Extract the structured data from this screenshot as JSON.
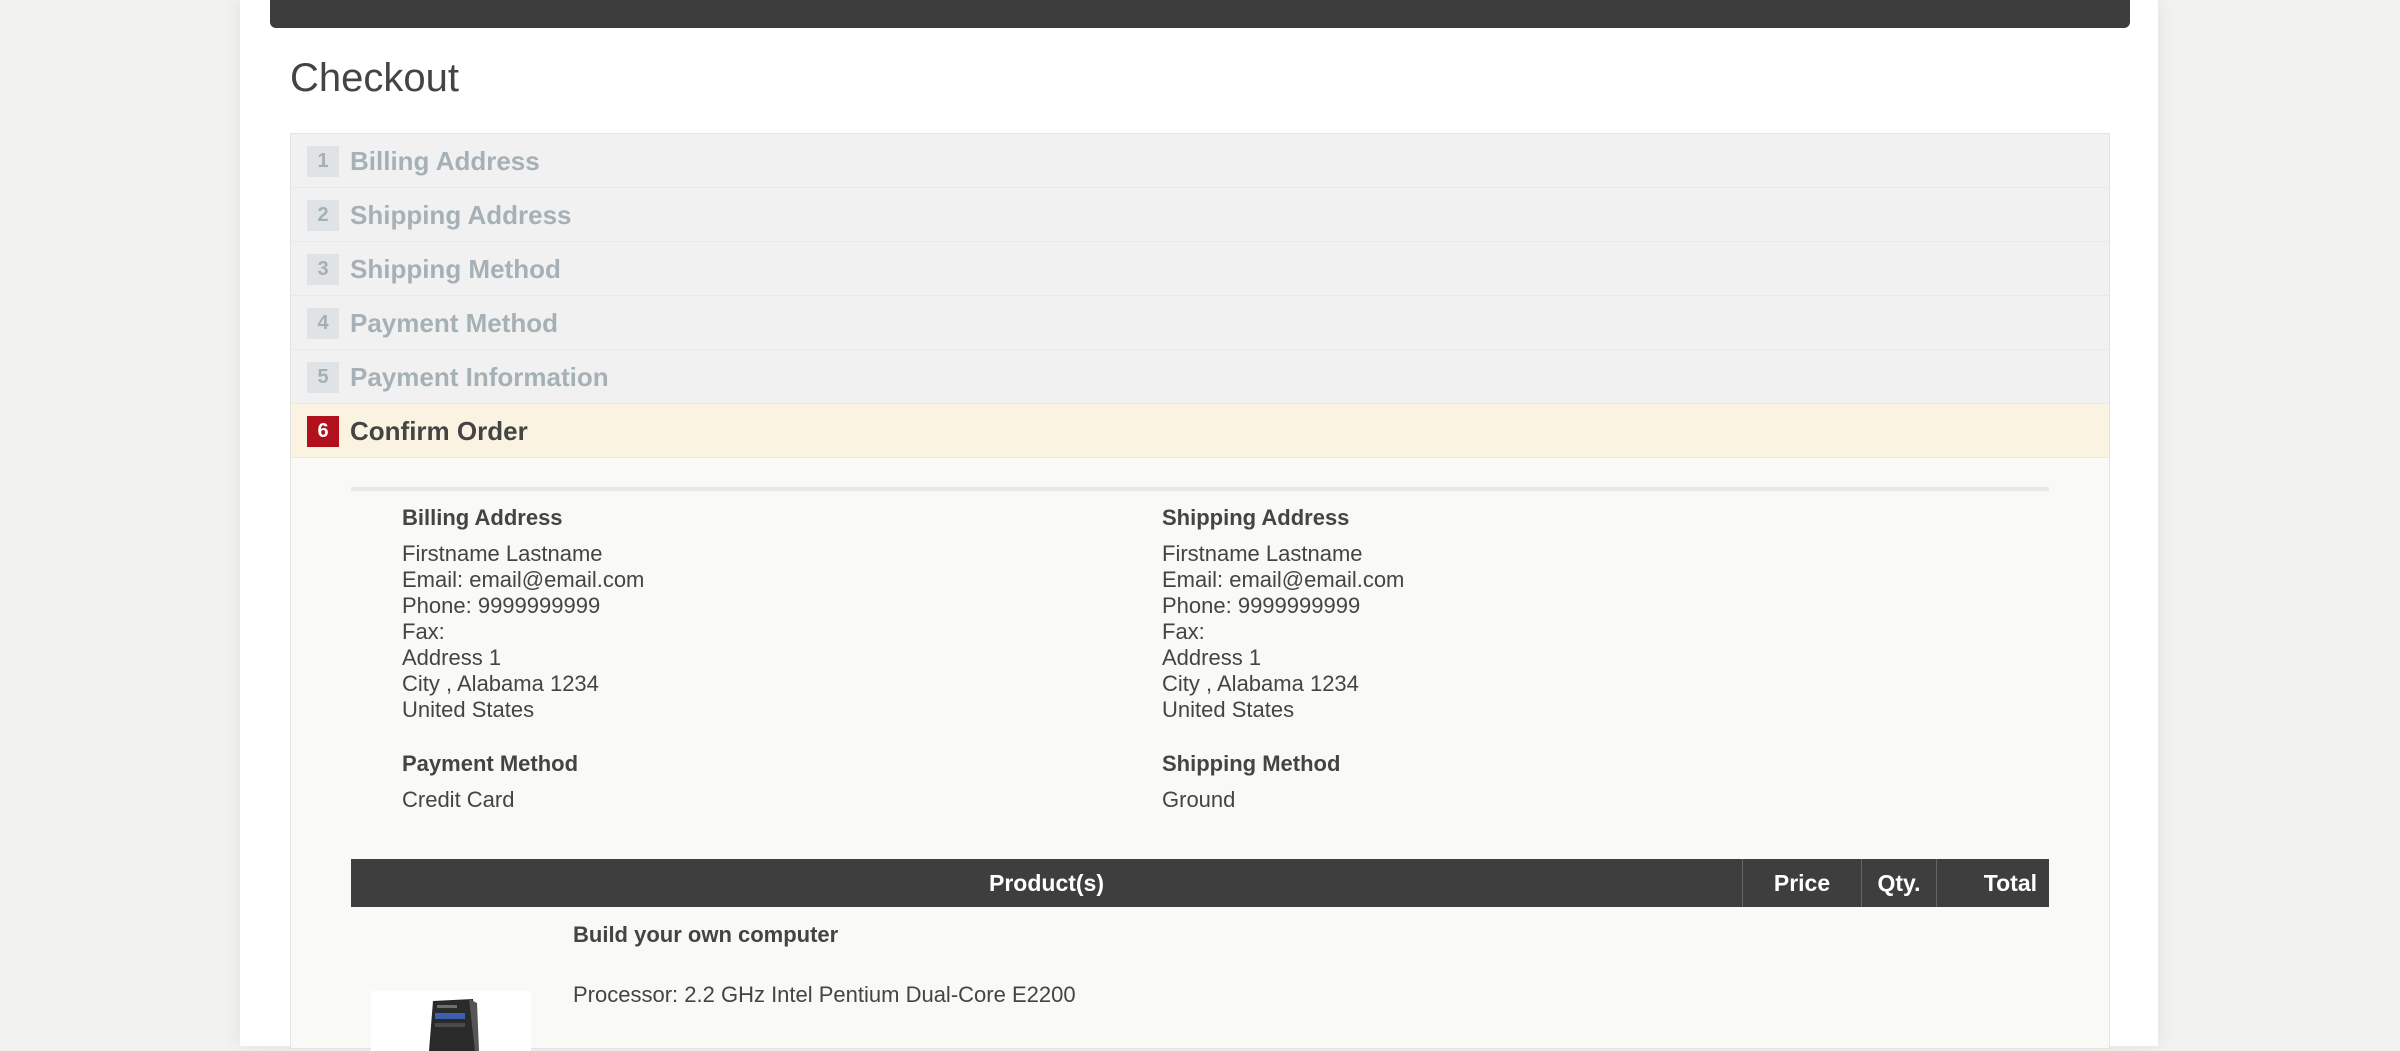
{
  "page": {
    "title": "Checkout"
  },
  "steps": [
    {
      "number": "1",
      "label": "Billing Address"
    },
    {
      "number": "2",
      "label": "Shipping Address"
    },
    {
      "number": "3",
      "label": "Shipping Method"
    },
    {
      "number": "4",
      "label": "Payment Method"
    },
    {
      "number": "5",
      "label": "Payment Information"
    },
    {
      "number": "6",
      "label": "Confirm Order"
    }
  ],
  "confirm": {
    "billing": {
      "heading": "Billing Address",
      "name": "Firstname Lastname",
      "email": "Email: email@email.com",
      "phone": "Phone: 9999999999",
      "fax": "Fax:",
      "address": "Address 1",
      "city": "City , Alabama 1234",
      "country": "United States"
    },
    "shipping": {
      "heading": "Shipping Address",
      "name": "Firstname Lastname",
      "email": "Email: email@email.com",
      "phone": "Phone: 9999999999",
      "fax": "Fax:",
      "address": "Address 1",
      "city": "City , Alabama 1234",
      "country": "United States"
    },
    "payment_method": {
      "heading": "Payment Method",
      "value": "Credit Card"
    },
    "shipping_method": {
      "heading": "Shipping Method",
      "value": "Ground"
    }
  },
  "table": {
    "headers": {
      "product": "Product(s)",
      "price": "Price",
      "qty": "Qty.",
      "total": "Total"
    },
    "rows": [
      {
        "name": "Build your own computer",
        "attribute": "Processor: 2.2 GHz Intel Pentium Dual-Core E2200"
      }
    ]
  },
  "colors": {
    "active_step": "#b2101c",
    "header_bar": "#3c3c3c"
  }
}
